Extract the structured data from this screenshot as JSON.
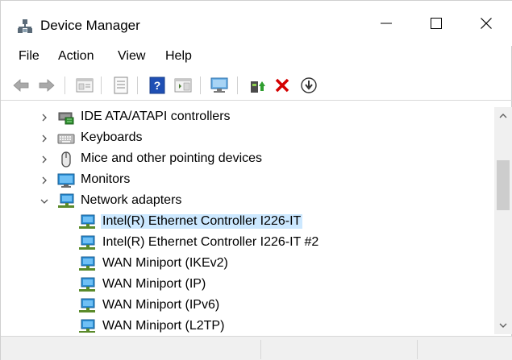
{
  "window": {
    "title": "Device Manager",
    "controls": [
      "minimize",
      "maximize",
      "close"
    ]
  },
  "menu": {
    "items": [
      {
        "label": "File"
      },
      {
        "label": "Action"
      },
      {
        "label": "View"
      },
      {
        "label": "Help"
      }
    ]
  },
  "toolbar": {
    "buttons": [
      {
        "icon": "back-arrow-icon",
        "enabled": false
      },
      {
        "icon": "forward-arrow-icon",
        "enabled": false
      },
      {
        "icon": "properties-pane-icon",
        "enabled": false
      },
      {
        "icon": "properties-icon",
        "enabled": true
      },
      {
        "icon": "help-icon",
        "enabled": true
      },
      {
        "icon": "show-hide-pane-icon",
        "enabled": true
      },
      {
        "icon": "scan-hardware-icon",
        "enabled": true
      },
      {
        "icon": "update-driver-icon",
        "enabled": true
      },
      {
        "icon": "uninstall-device-icon",
        "enabled": true
      },
      {
        "icon": "disable-device-icon",
        "enabled": true
      }
    ]
  },
  "tree": {
    "items": [
      {
        "label": "IDE ATA/ATAPI controllers",
        "icon": "ide-controller-icon",
        "expanded": false,
        "level": 0
      },
      {
        "label": "Keyboards",
        "icon": "keyboard-icon",
        "expanded": false,
        "level": 0
      },
      {
        "label": "Mice and other pointing devices",
        "icon": "mouse-icon",
        "expanded": false,
        "level": 0
      },
      {
        "label": "Monitors",
        "icon": "monitor-icon",
        "expanded": false,
        "level": 0
      },
      {
        "label": "Network adapters",
        "icon": "network-adapter-icon",
        "expanded": true,
        "level": 0
      },
      {
        "label": "Intel(R) Ethernet Controller I226-IT",
        "icon": "network-adapter-icon",
        "level": 1,
        "selected": true
      },
      {
        "label": "Intel(R) Ethernet Controller I226-IT #2",
        "icon": "network-adapter-icon",
        "level": 1
      },
      {
        "label": "WAN Miniport (IKEv2)",
        "icon": "network-adapter-icon",
        "level": 1
      },
      {
        "label": "WAN Miniport (IP)",
        "icon": "network-adapter-icon",
        "level": 1
      },
      {
        "label": "WAN Miniport (IPv6)",
        "icon": "network-adapter-icon",
        "level": 1
      },
      {
        "label": "WAN Miniport (L2TP)",
        "icon": "network-adapter-icon",
        "level": 1
      }
    ]
  },
  "colors": {
    "selection": "#cce8ff",
    "uninstall_red": "#d40000",
    "help_blue": "#1f4fb4",
    "network_blue": "#2b8fd6"
  }
}
